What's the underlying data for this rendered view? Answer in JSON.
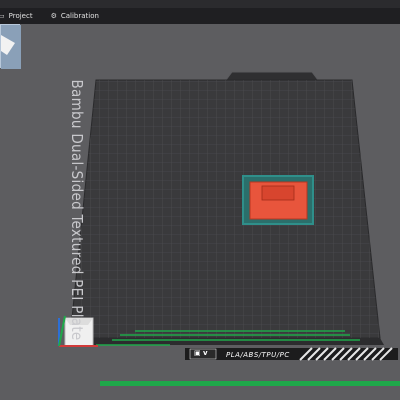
{
  "window": {
    "title": ""
  },
  "tabs": [
    {
      "label": "Project"
    },
    {
      "label": "Calibration"
    }
  ],
  "plate": {
    "label": "Bambu Dual-Sided Textured PEI Plate",
    "filament_label": "PLA/ABS/TPU/PC"
  },
  "colors": {
    "background": "#5d5d60",
    "plate": "#3a3a3c",
    "grid": "#4c4c4f",
    "model": "#e8553c",
    "selection": "#2f8f8a",
    "accent_green": "#1fa84a"
  },
  "icons": [
    "project-icon",
    "calibration-icon",
    "plate-thumbnail-icon",
    "axis-cube-icon"
  ]
}
